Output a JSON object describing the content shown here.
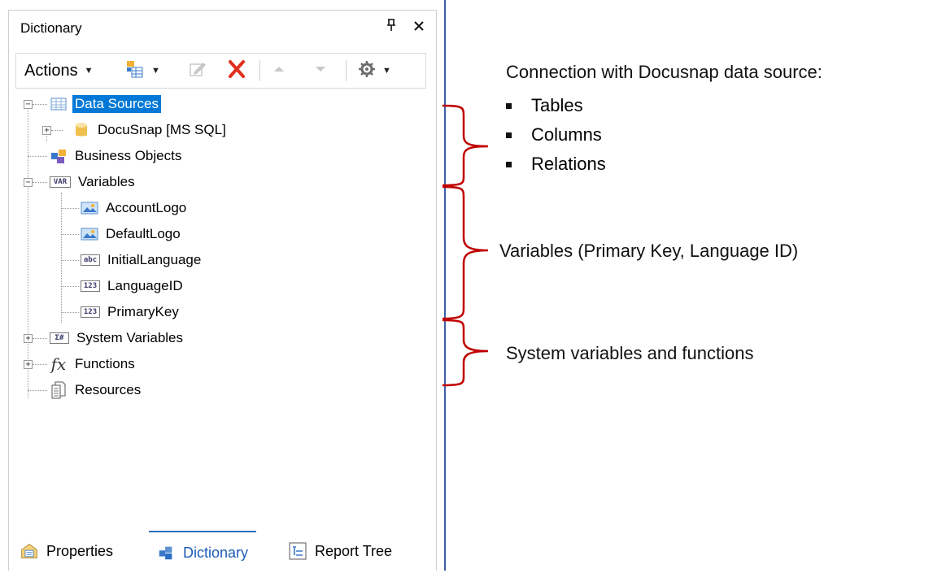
{
  "panel": {
    "title": "Dictionary",
    "pin_icon": "pin-icon",
    "close_icon": "close-icon"
  },
  "toolbar": {
    "actions_label": "Actions",
    "icons": [
      "new-item-icon",
      "edit-icon",
      "delete-icon",
      "move-up-icon",
      "move-down-icon",
      "settings-icon"
    ]
  },
  "tree": {
    "data_sources": "Data Sources",
    "docusnap": "DocuSnap [MS SQL]",
    "business_objects": "Business Objects",
    "variables": "Variables",
    "account_logo": "AccountLogo",
    "default_logo": "DefaultLogo",
    "initial_language": "InitialLanguage",
    "language_id": "LanguageID",
    "primary_key": "PrimaryKey",
    "system_variables": "System Variables",
    "functions": "Functions",
    "resources": "Resources",
    "var_badge": "VAR",
    "abc_badge": "abc",
    "num_badge": "123",
    "sys_badge": "Σ#",
    "fx_badge": "fx"
  },
  "tabs": {
    "properties": "Properties",
    "dictionary": "Dictionary",
    "report_tree": "Report Tree"
  },
  "annotations": {
    "connection_heading": "Connection with Docusnap data source:",
    "connection_items": [
      "Tables",
      "Columns",
      "Relations"
    ],
    "variables_note": "Variables (Primary Key, Language ID)",
    "system_note": "System variables and functions"
  },
  "colors": {
    "selection": "#0078d7",
    "brace": "#c00000",
    "divider": "#3b5fa8",
    "delete": "#e0301e"
  }
}
